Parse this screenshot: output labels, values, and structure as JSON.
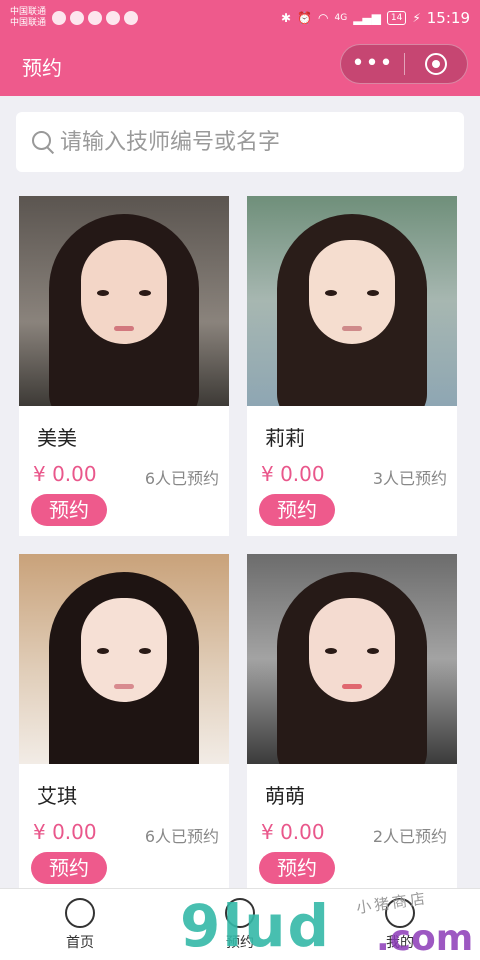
{
  "status_bar": {
    "carrier_1": "中国联通",
    "carrier_2": "中国联通",
    "network": "4G",
    "battery": "14",
    "time": "15:19"
  },
  "header": {
    "title": "预约",
    "more_label": "•••",
    "accent_color": "#ee5a8c"
  },
  "search": {
    "placeholder": "请输入技师编号或名字"
  },
  "technicians": [
    {
      "name": "美美",
      "price": "¥ 0.00",
      "booked": "6人已预约",
      "button": "预约"
    },
    {
      "name": "莉莉",
      "price": "¥ 0.00",
      "booked": "3人已预约",
      "button": "预约"
    },
    {
      "name": "艾琪",
      "price": "¥ 0.00",
      "booked": "6人已预约",
      "button": "预约"
    },
    {
      "name": "萌萌",
      "price": "¥ 0.00",
      "booked": "2人已预约",
      "button": "预约"
    }
  ],
  "tabbar": {
    "items": [
      {
        "label": "首页",
        "icon": "home-icon"
      },
      {
        "label": "预约",
        "icon": "calendar-icon"
      },
      {
        "label": "我的",
        "icon": "user-icon"
      }
    ]
  },
  "watermark": {
    "brand": "9lud",
    "domain": ".com",
    "tagline": "小猪商店"
  }
}
